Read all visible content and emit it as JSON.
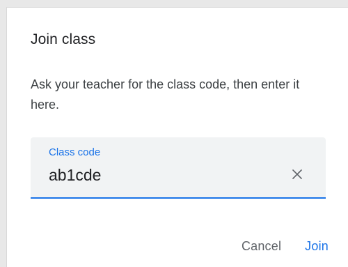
{
  "dialog": {
    "title": "Join class",
    "description": "Ask your teacher for the class code, then enter it here.",
    "field": {
      "label": "Class code",
      "value": "ab1cde",
      "clear_icon": "close-icon"
    },
    "actions": {
      "cancel_label": "Cancel",
      "join_label": "Join"
    }
  },
  "colors": {
    "accent": "#1a73e8",
    "field_background": "#f1f3f4",
    "text_primary": "#202124",
    "text_secondary": "#5f6368"
  }
}
